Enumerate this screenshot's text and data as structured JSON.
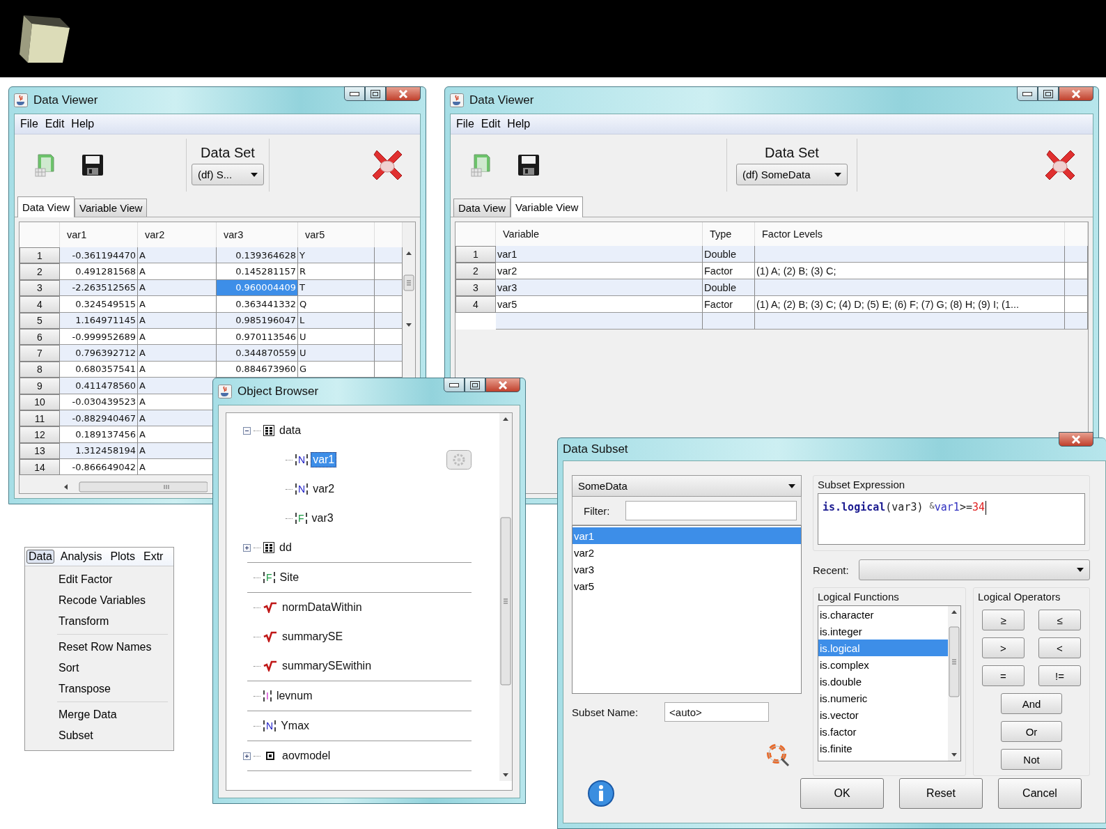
{
  "data_viewer_left": {
    "title": "Data Viewer",
    "menu": [
      "File",
      "Edit",
      "Help"
    ],
    "data_set_label": "Data Set",
    "data_set": "(df) S...",
    "tabs": [
      {
        "label": "Data View",
        "selected": true
      },
      {
        "label": "Variable View",
        "selected": false
      }
    ],
    "table": {
      "columns": [
        {
          "label": "var1",
          "kind": "numeric"
        },
        {
          "label": "var2",
          "kind": "text"
        },
        {
          "label": "var3",
          "kind": "numeric"
        },
        {
          "label": "var5",
          "kind": "text"
        }
      ],
      "rows": [
        {
          "number": "1",
          "cells": [
            {
              "text": "-0.361194470",
              "selected": false
            },
            {
              "text": "A",
              "selected": false
            },
            {
              "text": "0.139364628",
              "selected": false
            },
            {
              "text": "Y",
              "selected": false
            }
          ]
        },
        {
          "number": "2",
          "cells": [
            {
              "text": "0.491281568",
              "selected": false
            },
            {
              "text": "A",
              "selected": false
            },
            {
              "text": "0.145281157",
              "selected": false
            },
            {
              "text": "R",
              "selected": false
            }
          ]
        },
        {
          "number": "3",
          "cells": [
            {
              "text": "-2.263512565",
              "selected": false
            },
            {
              "text": "A",
              "selected": false
            },
            {
              "text": "0.960004409",
              "selected": true
            },
            {
              "text": "T",
              "selected": false
            }
          ]
        },
        {
          "number": "4",
          "cells": [
            {
              "text": "0.324549515",
              "selected": false
            },
            {
              "text": "A",
              "selected": false
            },
            {
              "text": "0.363441332",
              "selected": false
            },
            {
              "text": "Q",
              "selected": false
            }
          ]
        },
        {
          "number": "5",
          "cells": [
            {
              "text": "1.164971145",
              "selected": false
            },
            {
              "text": "A",
              "selected": false
            },
            {
              "text": "0.985196047",
              "selected": false
            },
            {
              "text": "L",
              "selected": false
            }
          ]
        },
        {
          "number": "6",
          "cells": [
            {
              "text": "-0.999952689",
              "selected": false
            },
            {
              "text": "A",
              "selected": false
            },
            {
              "text": "0.970113546",
              "selected": false
            },
            {
              "text": "U",
              "selected": false
            }
          ]
        },
        {
          "number": "7",
          "cells": [
            {
              "text": "0.796392712",
              "selected": false
            },
            {
              "text": "A",
              "selected": false
            },
            {
              "text": "0.344870559",
              "selected": false
            },
            {
              "text": "U",
              "selected": false
            }
          ]
        },
        {
          "number": "8",
          "cells": [
            {
              "text": "0.680357541",
              "selected": false
            },
            {
              "text": "A",
              "selected": false
            },
            {
              "text": "0.884673960",
              "selected": false
            },
            {
              "text": "G",
              "selected": false
            }
          ]
        },
        {
          "number": "9",
          "cells": [
            {
              "text": "0.411478560",
              "selected": false
            },
            {
              "text": "A",
              "selected": false
            }
          ]
        },
        {
          "number": "10",
          "cells": [
            {
              "text": "-0.030439523",
              "selected": false
            },
            {
              "text": "A",
              "selected": false
            }
          ]
        },
        {
          "number": "11",
          "cells": [
            {
              "text": "-0.882940467",
              "selected": false
            },
            {
              "text": "A",
              "selected": false
            }
          ]
        },
        {
          "number": "12",
          "cells": [
            {
              "text": "0.189137456",
              "selected": false
            },
            {
              "text": "A",
              "selected": false
            }
          ]
        },
        {
          "number": "13",
          "cells": [
            {
              "text": "1.312458194",
              "selected": false
            },
            {
              "text": "A",
              "selected": false
            }
          ]
        },
        {
          "number": "14",
          "cells": [
            {
              "text": "-0.866649042",
              "selected": false
            },
            {
              "text": "A",
              "selected": false
            }
          ]
        }
      ]
    }
  },
  "data_viewer_right": {
    "title": "Data Viewer",
    "menu": [
      "File",
      "Edit",
      "Help"
    ],
    "data_set_label": "Data Set",
    "data_set": "(df) SomeData",
    "tabs": [
      {
        "label": "Data View",
        "selected": false
      },
      {
        "label": "Variable View",
        "selected": true
      }
    ],
    "table": {
      "columns": [
        "Variable",
        "Type",
        "Factor Levels"
      ],
      "rows": [
        {
          "number": "1",
          "variable": "var1",
          "type": "Double"
        },
        {
          "number": "2",
          "variable": "var2",
          "type": "Factor",
          "factor_levels": "(1) A; (2) B; (3) C;"
        },
        {
          "number": "3",
          "variable": "var3",
          "type": "Double"
        },
        {
          "number": "4",
          "variable": "var5",
          "type": "Factor",
          "factor_levels": "(1) A; (2) B; (3) C; (4) D; (5) E; (6) F; (7) G; (8) H; (9) I; (1..."
        }
      ]
    }
  },
  "data_menu": {
    "menu_bar": [
      {
        "label": "Data",
        "selected": true
      },
      {
        "label": "Analysis",
        "selected": false
      },
      {
        "label": "Plots",
        "selected": false
      },
      {
        "label": "Extr",
        "selected": false
      }
    ],
    "sections": [
      [
        "Edit Factor",
        "Recode Variables",
        "Transform"
      ],
      [
        "Reset Row Names",
        "Sort",
        "Transpose"
      ],
      [
        "Merge Data",
        "Subset"
      ]
    ]
  },
  "object_browser": {
    "title": "Object Browser",
    "tree": [
      {
        "label": "data",
        "kind": "dataframe",
        "expanded": true,
        "selected": false,
        "separator": false,
        "children": [
          {
            "label": "var1",
            "kind": "numeric",
            "letter": "N",
            "selected": true
          },
          {
            "label": "var2",
            "kind": "numeric",
            "letter": "N",
            "selected": false
          },
          {
            "label": "var3",
            "kind": "factor",
            "letter": "F",
            "selected": false
          }
        ]
      },
      {
        "label": "dd",
        "kind": "dataframe",
        "expanded": false,
        "selected": false,
        "separator": true
      },
      {
        "label": "Site",
        "kind": "factor",
        "letter": "F",
        "selected": false,
        "separator": true
      },
      {
        "label": "normDataWithin",
        "kind": "function",
        "selected": false,
        "separator": false
      },
      {
        "label": "summarySE",
        "kind": "function",
        "selected": false,
        "separator": false
      },
      {
        "label": "summarySEwithin",
        "kind": "function",
        "selected": false,
        "separator": true
      },
      {
        "label": "levnum",
        "kind": "integer",
        "letter": "I",
        "selected": false,
        "separator": true
      },
      {
        "label": "Ymax",
        "kind": "numeric",
        "letter": "N",
        "selected": false,
        "separator": true
      },
      {
        "label": "aovmodel",
        "kind": "model",
        "expanded": false,
        "selected": false,
        "separator": true
      }
    ]
  },
  "data_subset": {
    "title": "Data Subset",
    "data_set": "SomeData",
    "filter_label": "Filter:",
    "variables": [
      {
        "label": "var1",
        "selected": true
      },
      {
        "label": "var2",
        "selected": false
      },
      {
        "label": "var3",
        "selected": false
      },
      {
        "label": "var5",
        "selected": false
      }
    ],
    "subset_name_label": "Subset Name:",
    "subset_name": "<auto>",
    "expression_title": "Subset Expression",
    "expression": [
      {
        "text": "is.logical",
        "kind": "function"
      },
      {
        "text": "(var3) ",
        "kind": "plain"
      },
      {
        "text": "&",
        "kind": "operator"
      },
      {
        "text": "var1",
        "kind": "variable"
      },
      {
        "text": ">=",
        "kind": "plain"
      },
      {
        "text": "34",
        "kind": "number"
      }
    ],
    "recent_label": "Recent:",
    "functions_title": "Logical Functions",
    "functions": [
      {
        "label": "is.character",
        "selected": false
      },
      {
        "label": "is.integer",
        "selected": false
      },
      {
        "label": "is.logical",
        "selected": true
      },
      {
        "label": "is.complex",
        "selected": false
      },
      {
        "label": "is.double",
        "selected": false
      },
      {
        "label": "is.numeric",
        "selected": false
      },
      {
        "label": "is.vector",
        "selected": false
      },
      {
        "label": "is.factor",
        "selected": false
      },
      {
        "label": "is.finite",
        "selected": false
      }
    ],
    "operators_title": "Logical Operators",
    "operators": [
      "≥",
      "≤",
      ">",
      "<",
      "=",
      "!=",
      "And",
      "Or",
      "Not"
    ],
    "buttons": [
      "OK",
      "Reset",
      "Cancel"
    ]
  }
}
